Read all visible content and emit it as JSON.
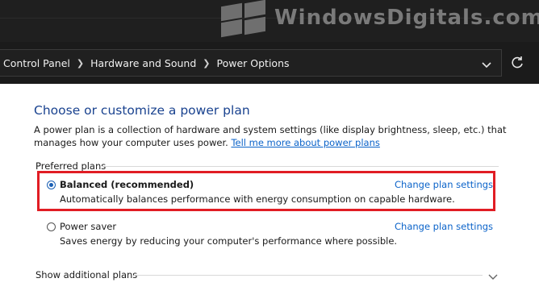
{
  "watermark": {
    "text": "WindowsDigitals.com"
  },
  "breadcrumb": {
    "items": [
      "Control Panel",
      "Hardware and Sound",
      "Power Options"
    ]
  },
  "icons": {
    "dropdown": "chevron-down-icon",
    "refresh": "refresh-icon",
    "expand": "chevron-down-icon"
  },
  "page": {
    "title": "Choose or customize a power plan",
    "description": "A power plan is a collection of hardware and system settings (like display brightness, sleep, etc.) that manages how your computer uses power.",
    "learn_more": "Tell me more about power plans"
  },
  "preferred_plans": {
    "label": "Preferred plans",
    "plans": [
      {
        "name": "Balanced (recommended)",
        "description": "Automatically balances performance with energy consumption on capable hardware.",
        "selected": true,
        "change_label": "Change plan settings"
      },
      {
        "name": "Power saver",
        "description": "Saves energy by reducing your computer's performance where possible.",
        "selected": false,
        "change_label": "Change plan settings"
      }
    ]
  },
  "additional": {
    "label": "Show additional plans"
  },
  "colors": {
    "highlight": "#e11d24",
    "link": "#0b63c9",
    "title": "#19428f"
  }
}
